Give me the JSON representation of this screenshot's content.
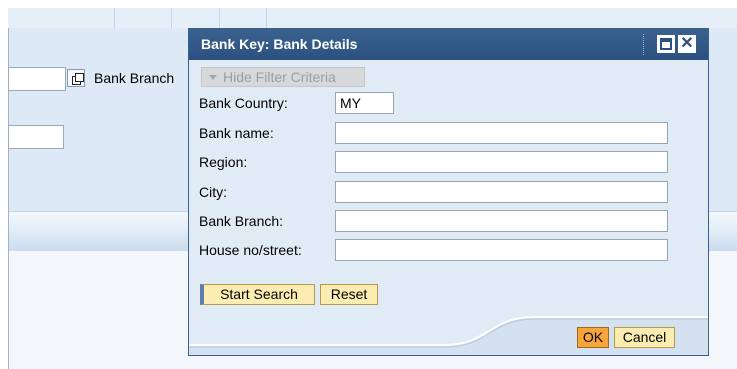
{
  "background": {
    "branch_label": "Bank Branch"
  },
  "dialog": {
    "title": "Bank Key: Bank Details",
    "hide_filter_label": "Hide Filter Criteria",
    "fields": [
      {
        "label": "Bank Country:",
        "value": "MY"
      },
      {
        "label": "Bank name:",
        "value": ""
      },
      {
        "label": "Region:",
        "value": ""
      },
      {
        "label": "City:",
        "value": ""
      },
      {
        "label": "Bank Branch:",
        "value": ""
      },
      {
        "label": "House no/street:",
        "value": ""
      }
    ],
    "start_search_label": "Start Search",
    "reset_label": "Reset",
    "ok_label": "OK",
    "cancel_label": "Cancel"
  },
  "icons": [
    "maximize-icon",
    "close-icon",
    "collapse-triangle-icon",
    "value-help-icon"
  ],
  "colors": {
    "title_bar": "#2c5180",
    "dialog_bg": "#e1ebf6",
    "button_bg": "#fbedb1",
    "ok_button_bg": "#f7a53a"
  }
}
